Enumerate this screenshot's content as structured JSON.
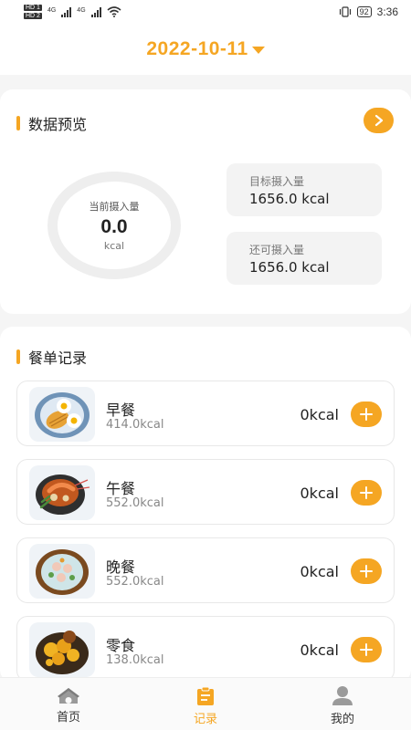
{
  "status_bar": {
    "sim_labels": [
      "HD 1",
      "HD 2"
    ],
    "network_labels": [
      "4G",
      "4G"
    ],
    "battery": "92",
    "time": "3:36"
  },
  "header": {
    "date": "2022-10-11",
    "accent_color": "#f5a623"
  },
  "overview": {
    "title": "数据预览",
    "arrow_icon": "chevron-right-icon",
    "current_intake": {
      "label": "当前摄入量",
      "value": "0.0",
      "unit": "kcal"
    },
    "target": {
      "label": "目标摄入量",
      "value": "1656.0 kcal"
    },
    "remaining": {
      "label": "还可摄入量",
      "value": "1656.0 kcal"
    }
  },
  "meals": {
    "title": "餐单记录",
    "items": [
      {
        "name": "早餐",
        "recommended": "414.0kcal",
        "total": "0kcal",
        "icon": "breakfast-icon"
      },
      {
        "name": "午餐",
        "recommended": "552.0kcal",
        "total": "0kcal",
        "icon": "lunch-icon"
      },
      {
        "name": "晚餐",
        "recommended": "552.0kcal",
        "total": "0kcal",
        "icon": "dinner-icon"
      },
      {
        "name": "零食",
        "recommended": "138.0kcal",
        "total": "0kcal",
        "icon": "snack-icon"
      }
    ]
  },
  "nav": {
    "items": [
      {
        "label": "首页",
        "icon": "home-icon"
      },
      {
        "label": "记录",
        "icon": "clipboard-icon",
        "active": true
      },
      {
        "label": "我的",
        "icon": "user-icon"
      }
    ]
  }
}
